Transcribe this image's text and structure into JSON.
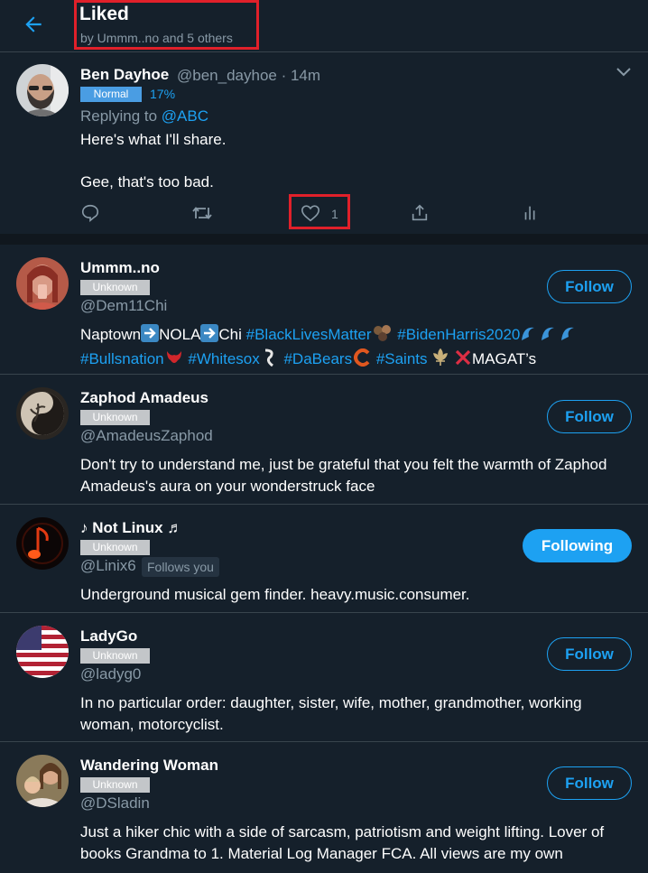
{
  "header": {
    "title": "Liked",
    "subtitle": "by Ummm..no and 5 others"
  },
  "tweet": {
    "name": "Ben Dayhoe",
    "handle_time": "@ben_dayhoe · 14m",
    "badge": "Normal",
    "percent": "17%",
    "replying_prefix": "Replying to ",
    "replying_to": "@ABC",
    "line1": "Here's what I'll share.",
    "line2": "Gee, that's too bad.",
    "like_count": "1"
  },
  "users": [
    {
      "name": "Ummm..no",
      "badge": "Unknown",
      "handle": "@Dem11Chi",
      "button": "Follow",
      "bio_parts": {
        "p1": "Naptown",
        "p2": "NOLA",
        "p3": "Chi ",
        "h1": "#BlackLivesMatter",
        "h2": "#BidenHarris2020",
        "h3": "#Bullsnation",
        "h4": "#Whitesox",
        "h5": "#DaBears",
        "h6": "#Saints",
        "p4": "MAGAT’s"
      }
    },
    {
      "name": "Zaphod Amadeus",
      "badge": "Unknown",
      "handle": "@AmadeusZaphod",
      "button": "Follow",
      "bio": "Don't try to understand me, just be grateful that you felt the warmth of Zaphod Amadeus's aura on your wonderstruck face"
    },
    {
      "name": "♪ Not Linux ♬",
      "badge": "Unknown",
      "handle": "@Linix6",
      "follows_you": "Follows you",
      "button": "Following",
      "bio": "Underground musical gem finder. heavy.music.consumer."
    },
    {
      "name": "LadyGo",
      "badge": "Unknown",
      "handle": "@ladyg0",
      "button": "Follow",
      "bio": "In no particular order: daughter, sister, wife, mother, grandmother, working woman, motorcyclist."
    },
    {
      "name": "Wandering Woman",
      "badge": "Unknown",
      "handle": "@DSladin",
      "button": "Follow",
      "bio": "Just a hiker chic with a side of sarcasm, patriotism and weight lifting. Lover of books Grandma to 1. Material Log Manager FCA. All views are my own"
    }
  ],
  "colors": {
    "background": "#15202b",
    "accent": "#1da1f2",
    "muted": "#8899a6",
    "highlight_box": "#e0202a"
  }
}
